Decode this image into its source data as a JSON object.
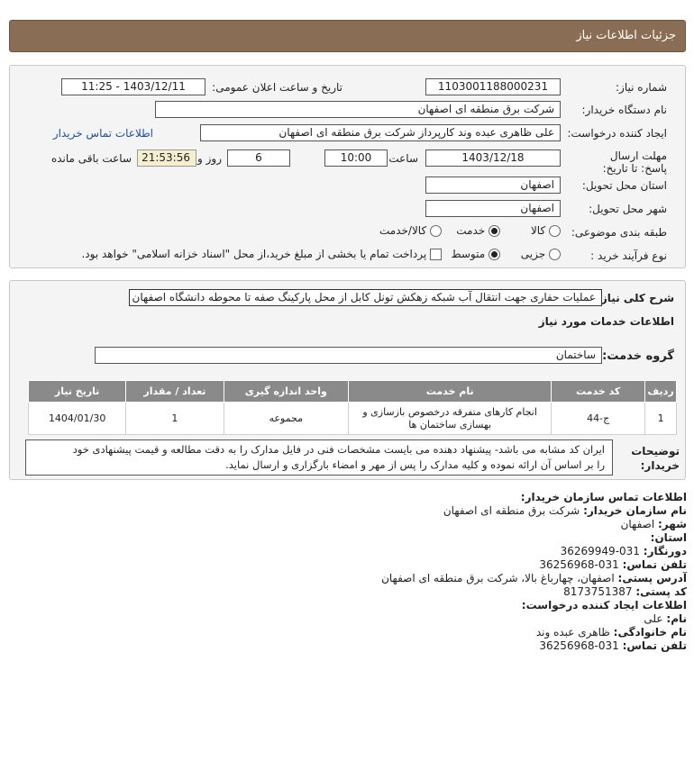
{
  "header": {
    "title": "جزئیات اطلاعات نیاز"
  },
  "form": {
    "need_number_label": "شماره نیاز:",
    "need_number": "1103001188000231",
    "announce_label": "تاریخ و ساعت اعلان عمومی:",
    "announce_value": "1403/12/11 - 11:25",
    "buyer_org_label": "نام دستگاه خریدار:",
    "buyer_org": "شرکت برق منطقه ای اصفهان",
    "requester_label": "ایجاد کننده درخواست:",
    "requester": "علی ظاهری عبده وند کارپرداز شرکت برق منطقه ای اصفهان",
    "contact_link": "اطلاعات تماس خریدار",
    "deadline_label": "مهلت ارسال پاسخ: تا تاریخ:",
    "deadline_date": "1403/12/18",
    "time_label": "ساعت",
    "deadline_time": "10:00",
    "days_value": "6",
    "days_label": "روز و",
    "remaining_time": "21:53:56",
    "remaining_label": "ساعت باقی مانده",
    "province_label": "استان محل تحویل:",
    "province": "اصفهان",
    "city_label": "شهر محل تحویل:",
    "city": "اصفهان",
    "category_label": "طبقه بندی موضوعی:",
    "category_options": [
      "کالا",
      "خدمت",
      "کالا/خدمت"
    ],
    "process_label": "نوع فرآیند خرید :",
    "process_options": [
      "جزیی",
      "متوسط"
    ],
    "payment_note": "پرداخت تمام یا بخشی از مبلغ خرید،از محل \"اسناد خزانه اسلامی\" خواهد بود."
  },
  "description": {
    "label": "شرح کلی نیاز:",
    "text": "عملیات حفاری جهت انتقال آب شبکه زهکش تونل کابل از محل پارکینگ صفه تا محوطه دانشگاه اصفهان",
    "services_heading": "اطلاعات خدمات مورد نیاز",
    "group_label": "گروه خدمت:",
    "group_value": "ساختمان"
  },
  "table": {
    "headers": [
      "ردیف",
      "کد خدمت",
      "نام خدمت",
      "واحد اندازه گیری",
      "تعداد / مقدار",
      "تاریخ نیاز"
    ],
    "row": [
      "1",
      "ج-44",
      "انجام کارهای متفرقه درخصوص بازسازی و بهسازی ساختمان ها",
      "مجموعه",
      "1",
      "1404/01/30"
    ]
  },
  "notes": {
    "label": "توضیحات خریدار:",
    "text_line1": "ایران کد مشابه می باشد- پیشنهاد دهنده می بایست مشخصات فنی در فایل مدارک را به دقت مطالعه و قیمت پیشنهادی خود",
    "text_line2": "را بر اساس آن ارائه نموده و کلیه مدارک را پس از مهر و امضاء بارگزاری و ارسال نماید."
  },
  "contact": {
    "org_heading": "اطلاعات تماس سازمان خریدار:",
    "buyer_name_label": "نام سازمان خریدار:",
    "buyer_name": "شرکت برق منطقه ای اصفهان",
    "city_label": "شهر:",
    "city": "اصفهان",
    "province_label": "استان:",
    "province": "",
    "fax_label": "دورنگار:",
    "fax": "031-36269949",
    "phone_label": "تلفن تماس:",
    "phone": "031-36256968",
    "address_label": "آدرس پستی:",
    "address": "اصفهان، چهارباغ بالا، شرکت برق منطقه ای اصفهان",
    "postal_label": "کد پستی:",
    "postal": "8173751387",
    "creator_heading": "اطلاعات ایجاد کننده درخواست:",
    "first_name_label": "نام:",
    "first_name": "علی",
    "last_name_label": "نام خانوادگی:",
    "last_name": "ظاهری عبده وند",
    "creator_phone_label": "تلفن تماس:",
    "creator_phone": "031-36256968"
  }
}
